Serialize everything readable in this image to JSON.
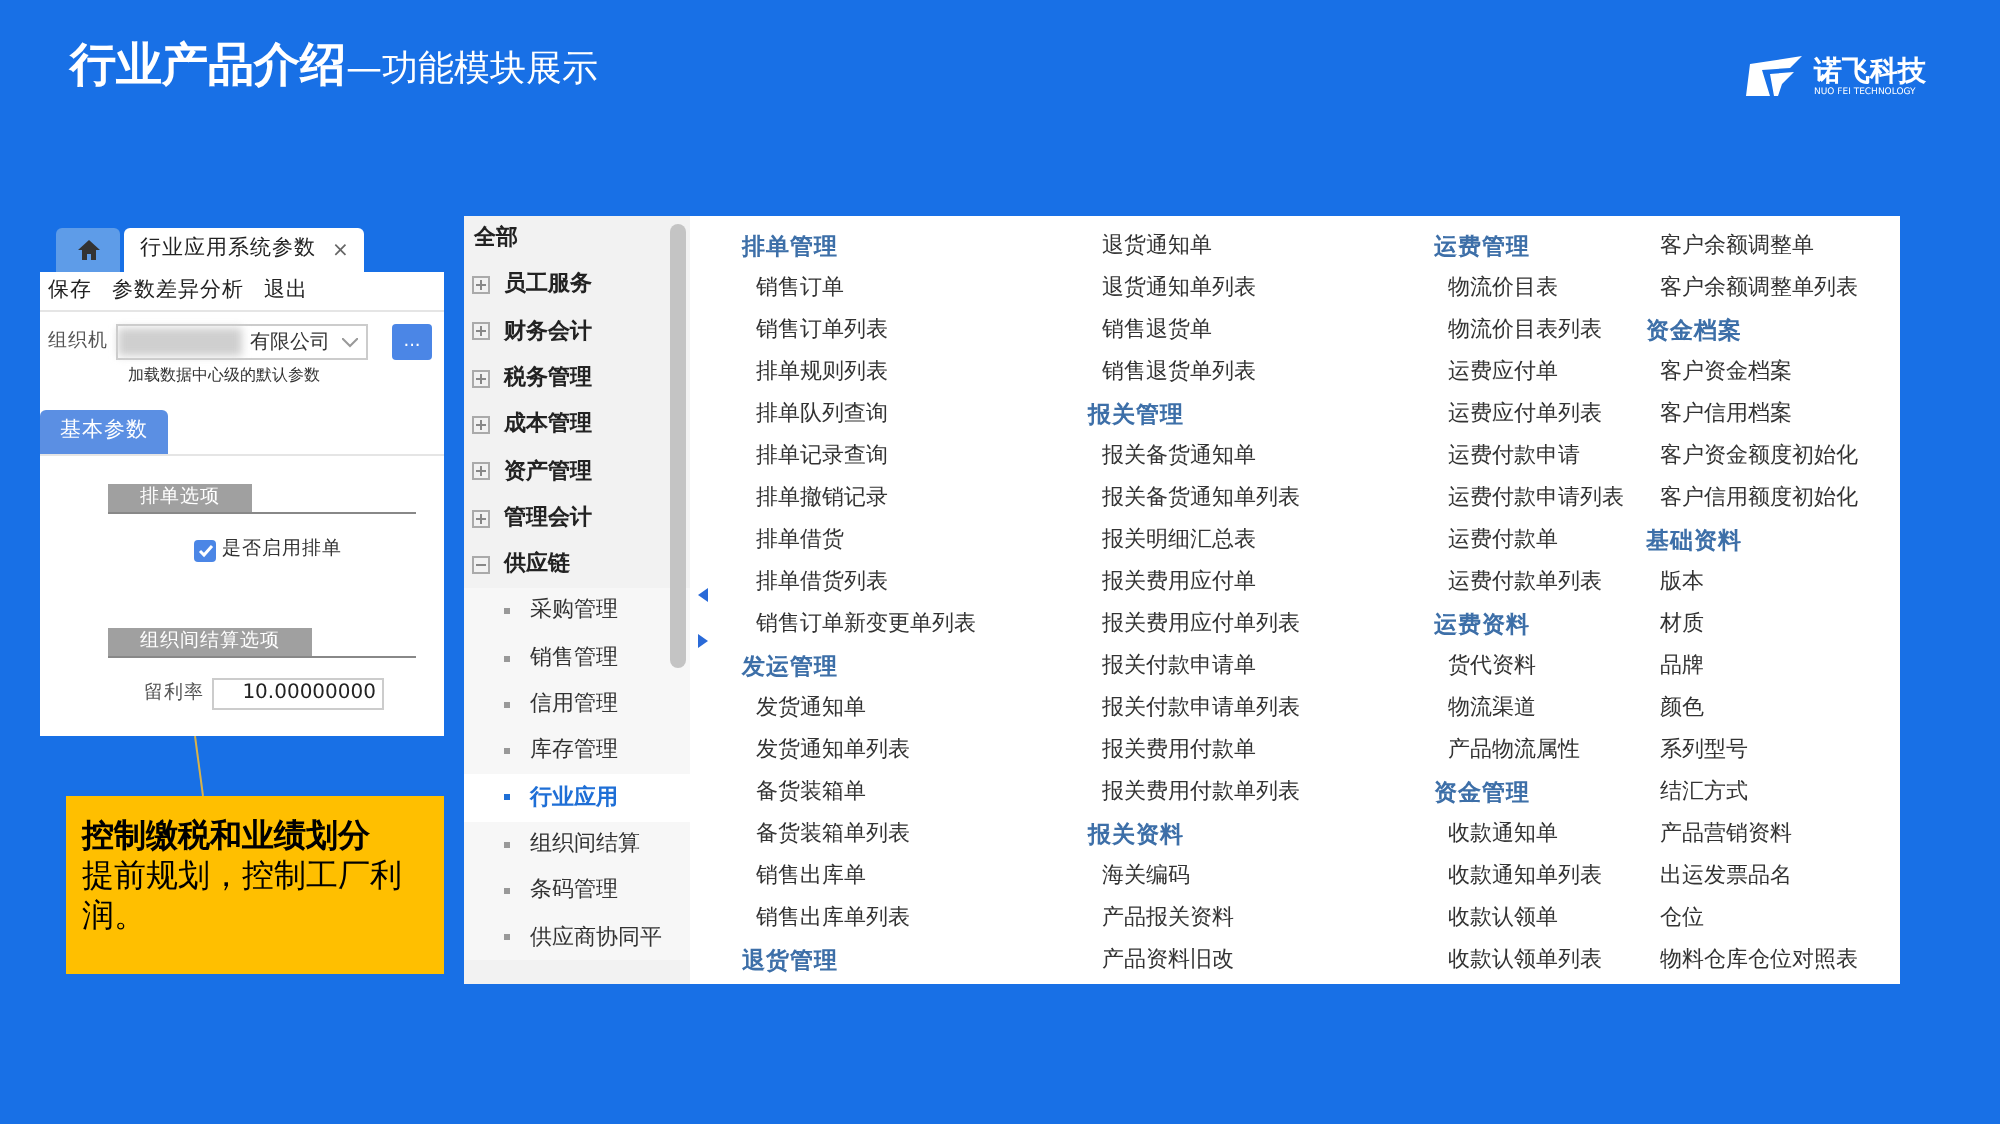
{
  "title": {
    "main": "行业产品介绍",
    "sub": "—功能模块展示"
  },
  "logo": {
    "name": "诺飞科技",
    "tagline": "NUO FEI TECHNOLOGY"
  },
  "params_window": {
    "tabs": [
      {
        "kind": "home",
        "selected": false
      },
      {
        "kind": "text",
        "label": "行业应用系统参数",
        "close": "×",
        "selected": true
      }
    ],
    "toolbar": [
      "保存",
      "参数差异分析",
      "退出"
    ],
    "org_label": "组织机",
    "org_value": "有限公司",
    "more_button": "...",
    "hint": "加载数据中心级的默认参数",
    "section_tab": "基本参数",
    "groups": [
      {
        "title": "排单选项",
        "checkbox": {
          "label": "是否启用排单",
          "checked": true
        }
      },
      {
        "title": "组织间结算选项",
        "field": {
          "label": "留利率",
          "value": "10.00000000"
        }
      }
    ]
  },
  "callout": {
    "heading": "控制缴税和业绩划分",
    "body": "提前规划，控制工厂利润。"
  },
  "tree": {
    "root": "全部",
    "items": [
      {
        "label": "员工服务",
        "expanded": false
      },
      {
        "label": "财务会计",
        "expanded": false
      },
      {
        "label": "税务管理",
        "expanded": false
      },
      {
        "label": "成本管理",
        "expanded": false
      },
      {
        "label": "资产管理",
        "expanded": false
      },
      {
        "label": "管理会计",
        "expanded": false
      },
      {
        "label": "供应链",
        "expanded": true,
        "children": [
          {
            "label": "采购管理",
            "selected": false
          },
          {
            "label": "销售管理",
            "selected": false
          },
          {
            "label": "信用管理",
            "selected": false
          },
          {
            "label": "库存管理",
            "selected": false
          },
          {
            "label": "行业应用",
            "selected": true
          },
          {
            "label": "组织间结算",
            "selected": false
          },
          {
            "label": "条码管理",
            "selected": false
          },
          {
            "label": "供应商协同平",
            "selected": false
          }
        ]
      }
    ]
  },
  "modules": [
    [
      {
        "kind": "heading",
        "text": "排单管理"
      },
      {
        "kind": "item",
        "text": "销售订单"
      },
      {
        "kind": "item",
        "text": "销售订单列表"
      },
      {
        "kind": "item",
        "text": "排单规则列表"
      },
      {
        "kind": "item",
        "text": "排单队列查询"
      },
      {
        "kind": "item",
        "text": "排单记录查询"
      },
      {
        "kind": "item",
        "text": "排单撤销记录"
      },
      {
        "kind": "item",
        "text": "排单借货"
      },
      {
        "kind": "item",
        "text": "排单借货列表"
      },
      {
        "kind": "item",
        "text": "销售订单新变更单列表"
      },
      {
        "kind": "heading",
        "text": "发运管理"
      },
      {
        "kind": "item",
        "text": "发货通知单"
      },
      {
        "kind": "item",
        "text": "发货通知单列表"
      },
      {
        "kind": "item",
        "text": "备货装箱单"
      },
      {
        "kind": "item",
        "text": "备货装箱单列表"
      },
      {
        "kind": "item",
        "text": "销售出库单"
      },
      {
        "kind": "item",
        "text": "销售出库单列表"
      },
      {
        "kind": "heading",
        "text": "退货管理"
      }
    ],
    [
      {
        "kind": "item",
        "text": "退货通知单"
      },
      {
        "kind": "item",
        "text": "退货通知单列表"
      },
      {
        "kind": "item",
        "text": "销售退货单"
      },
      {
        "kind": "item",
        "text": "销售退货单列表"
      },
      {
        "kind": "heading",
        "text": "报关管理"
      },
      {
        "kind": "item",
        "text": "报关备货通知单"
      },
      {
        "kind": "item",
        "text": "报关备货通知单列表"
      },
      {
        "kind": "item",
        "text": "报关明细汇总表"
      },
      {
        "kind": "item",
        "text": "报关费用应付单"
      },
      {
        "kind": "item",
        "text": "报关费用应付单列表"
      },
      {
        "kind": "item",
        "text": "报关付款申请单"
      },
      {
        "kind": "item",
        "text": "报关付款申请单列表"
      },
      {
        "kind": "item",
        "text": "报关费用付款单"
      },
      {
        "kind": "item",
        "text": "报关费用付款单列表"
      },
      {
        "kind": "heading",
        "text": "报关资料"
      },
      {
        "kind": "item",
        "text": "海关编码"
      },
      {
        "kind": "item",
        "text": "产品报关资料"
      },
      {
        "kind": "item",
        "text": "产品资料旧改"
      }
    ],
    [
      {
        "kind": "heading",
        "text": "运费管理"
      },
      {
        "kind": "item",
        "text": "物流价目表"
      },
      {
        "kind": "item",
        "text": "物流价目表列表"
      },
      {
        "kind": "item",
        "text": "运费应付单"
      },
      {
        "kind": "item",
        "text": "运费应付单列表"
      },
      {
        "kind": "item",
        "text": "运费付款申请"
      },
      {
        "kind": "item",
        "text": "运费付款申请列表"
      },
      {
        "kind": "item",
        "text": "运费付款单"
      },
      {
        "kind": "item",
        "text": "运费付款单列表"
      },
      {
        "kind": "heading",
        "text": "运费资料"
      },
      {
        "kind": "item",
        "text": "货代资料"
      },
      {
        "kind": "item",
        "text": "物流渠道"
      },
      {
        "kind": "item",
        "text": "产品物流属性"
      },
      {
        "kind": "heading",
        "text": "资金管理"
      },
      {
        "kind": "item",
        "text": "收款通知单"
      },
      {
        "kind": "item",
        "text": "收款通知单列表"
      },
      {
        "kind": "item",
        "text": "收款认领单"
      },
      {
        "kind": "item",
        "text": "收款认领单列表"
      }
    ],
    [
      {
        "kind": "item",
        "text": "客户余额调整单"
      },
      {
        "kind": "item",
        "text": "客户余额调整单列表"
      },
      {
        "kind": "heading",
        "text": "资金档案"
      },
      {
        "kind": "item",
        "text": "客户资金档案"
      },
      {
        "kind": "item",
        "text": "客户信用档案"
      },
      {
        "kind": "item",
        "text": "客户资金额度初始化"
      },
      {
        "kind": "item",
        "text": "客户信用额度初始化"
      },
      {
        "kind": "heading",
        "text": "基础资料"
      },
      {
        "kind": "item",
        "text": "版本"
      },
      {
        "kind": "item",
        "text": "材质"
      },
      {
        "kind": "item",
        "text": "品牌"
      },
      {
        "kind": "item",
        "text": "颜色"
      },
      {
        "kind": "item",
        "text": "系列型号"
      },
      {
        "kind": "item",
        "text": "结汇方式"
      },
      {
        "kind": "item",
        "text": "产品营销资料"
      },
      {
        "kind": "item",
        "text": "出运发票品名"
      },
      {
        "kind": "item",
        "text": "仓位"
      },
      {
        "kind": "item",
        "text": "物料仓库仓位对照表"
      }
    ]
  ]
}
